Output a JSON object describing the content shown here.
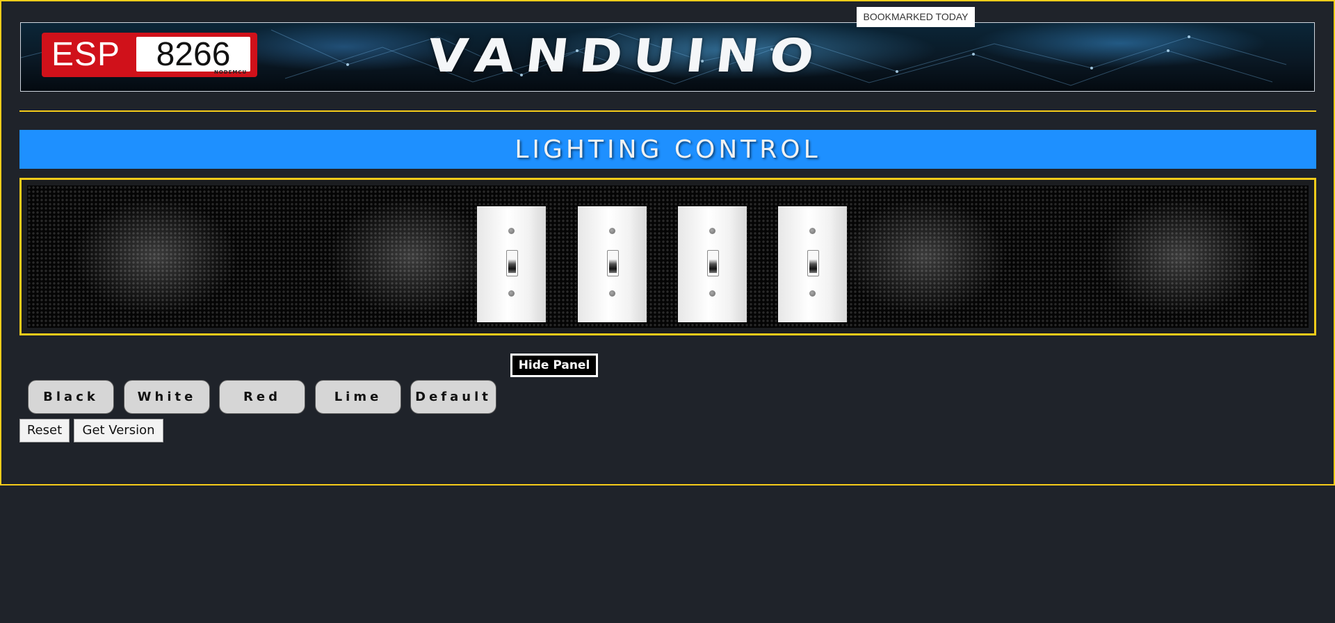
{
  "header": {
    "logo_prefix": "ESP",
    "logo_number": "8266",
    "logo_subtitle": "NODEMCU",
    "site_title": "VANDUINO",
    "bookmark_badge": "BOOKMARKED TODAY"
  },
  "section": {
    "title": "LIGHTING CONTROL"
  },
  "switches": [
    {
      "name": "switch-1",
      "state": "off"
    },
    {
      "name": "switch-2",
      "state": "off"
    },
    {
      "name": "switch-3",
      "state": "off"
    },
    {
      "name": "switch-4",
      "state": "off"
    }
  ],
  "controls": {
    "hide_panel_label": "Hide Panel",
    "color_buttons": [
      "Black",
      "White",
      "Red",
      "Lime",
      "Default"
    ],
    "reset_label": "Reset",
    "get_version_label": "Get Version"
  },
  "colors": {
    "page_background": "#1f232a",
    "accent_yellow": "#f5cc1a",
    "title_blue": "#1e90ff",
    "logo_red": "#d0111a"
  }
}
